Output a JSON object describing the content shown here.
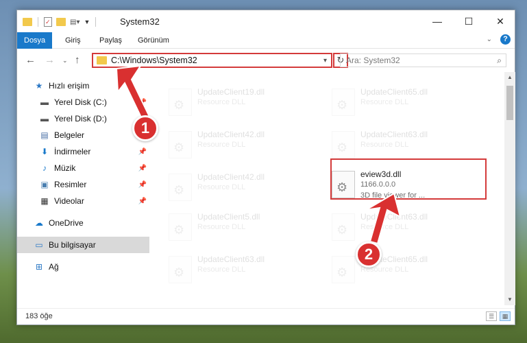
{
  "window": {
    "title": "System32"
  },
  "ribbon": {
    "tabs": [
      "Dosya",
      "Giriş",
      "Paylaş",
      "Görünüm"
    ]
  },
  "address": {
    "path": "C:\\Windows\\System32"
  },
  "search": {
    "placeholder": "Ara: System32"
  },
  "sidebar": {
    "items": [
      {
        "label": "Hızlı erişim",
        "icon": "star-icon"
      },
      {
        "label": "Yerel Disk (C:)",
        "icon": "drive-icon",
        "pinned": true
      },
      {
        "label": "Yerel Disk (D:)",
        "icon": "drive-icon"
      },
      {
        "label": "Belgeler",
        "icon": "documents-icon"
      },
      {
        "label": "İndirmeler",
        "icon": "download-icon",
        "pinned": true
      },
      {
        "label": "Müzik",
        "icon": "music-icon",
        "pinned": true
      },
      {
        "label": "Resimler",
        "icon": "pictures-icon",
        "pinned": true
      },
      {
        "label": "Videolar",
        "icon": "videos-icon",
        "pinned": true
      },
      {
        "label": "OneDrive",
        "icon": "cloud-icon"
      },
      {
        "label": "Bu bilgisayar",
        "icon": "computer-icon",
        "selected": true
      },
      {
        "label": "Ağ",
        "icon": "network-icon"
      }
    ]
  },
  "files": {
    "left": [
      {
        "name": "UpdateClient19.dll",
        "type": "Resource DLL"
      },
      {
        "name": "UpdateClient42.dll",
        "type": "Resource DLL"
      },
      {
        "name": "UpdateClient42.dll",
        "type": "Resource DLL"
      },
      {
        "name": "UpdateClient5.dll",
        "type": "Resource DLL"
      },
      {
        "name": "UpdateClient63.dll",
        "type": "Resource DLL"
      }
    ],
    "right": [
      {
        "name": "UpdateClient65.dll",
        "type": "Resource DLL"
      },
      {
        "name": "UpdateClient63.dll",
        "type": "Resource DLL"
      },
      {
        "name": "UpdateClient63.dll",
        "type": "Resource DLL"
      },
      {
        "name": "UpdateClient65.dll",
        "type": "Resource DLL"
      }
    ],
    "highlighted": {
      "name": "eview3d.dll",
      "version": "1166.0.0.0",
      "description": "3D file viewer for ..."
    }
  },
  "status": {
    "count": "183 öğe"
  },
  "annotations": {
    "step1": "1",
    "step2": "2"
  },
  "colors": {
    "accent": "#1979ca",
    "annotation": "#d93030"
  }
}
